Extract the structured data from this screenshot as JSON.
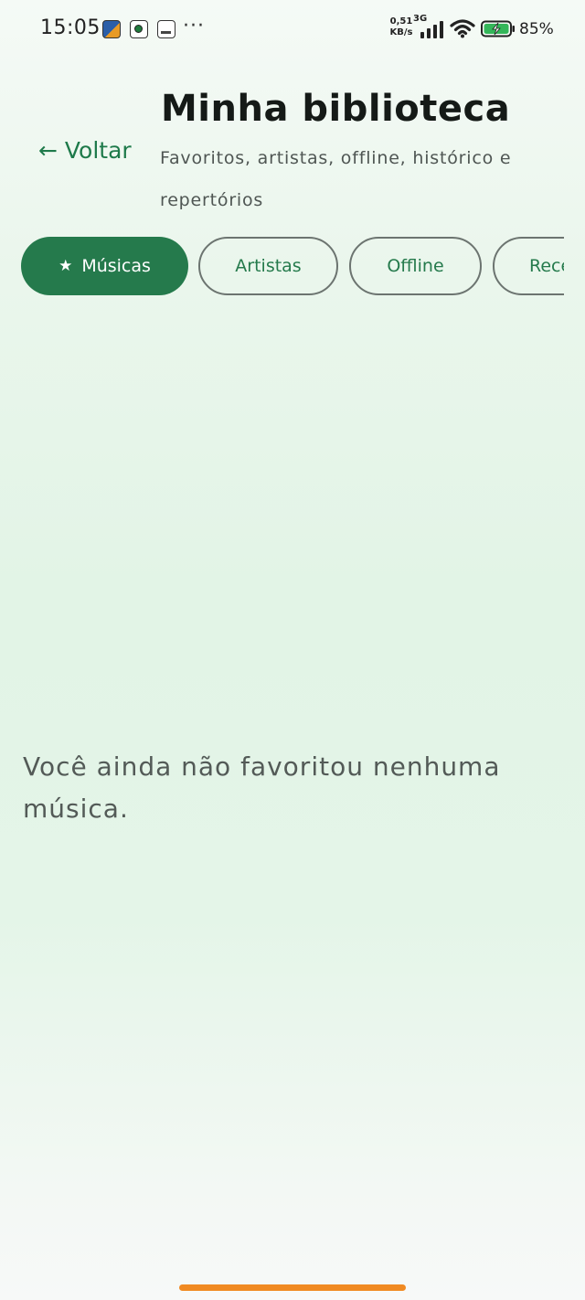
{
  "status_bar": {
    "time": "15:05",
    "more": "···",
    "net_speed_value": "0,51",
    "net_speed_unit": "KB/s",
    "net_type": "3G",
    "battery": "85%"
  },
  "header": {
    "back_label": "← Voltar",
    "title": "Minha biblioteca",
    "subtitle": "Favoritos, artistas, offline, histórico e repertórios"
  },
  "tabs": [
    {
      "label": "Músicas",
      "icon": "star-icon",
      "active": true
    },
    {
      "label": "Artistas",
      "active": false
    },
    {
      "label": "Offline",
      "active": false
    },
    {
      "label": "Rece",
      "active": false
    }
  ],
  "empty_state": {
    "message": "Você ainda não favoritou nenhuma música."
  },
  "colors": {
    "accent": "#257a4c",
    "home_indicator": "#f08a22"
  }
}
